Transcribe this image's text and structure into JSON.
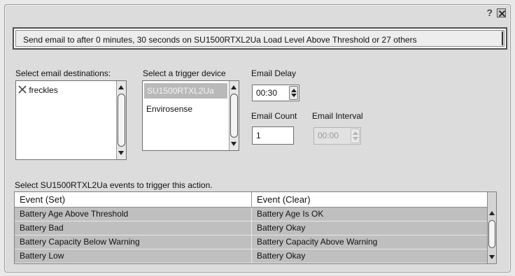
{
  "titlebar": {
    "help_icon": "?",
    "close_icon": "close-box-icon"
  },
  "summary": "Send email to  after 0 minutes, 30 seconds on SU1500RTXL2Ua Load Level Above Threshold or 27 others",
  "destinations": {
    "label": "Select email destinations:",
    "items": [
      {
        "label": "freckles",
        "icon": "x-mark-icon"
      }
    ]
  },
  "trigger_device": {
    "label": "Select a trigger device",
    "items": [
      {
        "label": "SU1500RTXL2Ua",
        "selected": true
      },
      {
        "label": "Envirosense",
        "selected": false
      }
    ]
  },
  "email_delay": {
    "label": "Email Delay",
    "value": "00:30"
  },
  "email_count": {
    "label": "Email Count",
    "value": "1"
  },
  "email_interval": {
    "label": "Email Interval",
    "value": "00:00",
    "disabled": true
  },
  "events": {
    "label": "Select SU1500RTXL2Ua events to trigger this action.",
    "columns": [
      "Event (Set)",
      "Event (Clear)"
    ],
    "rows": [
      [
        "Battery Age Above Threshold",
        "Battery Age Is OK"
      ],
      [
        "Battery Bad",
        "Battery Okay"
      ],
      [
        "Battery Capacity Below Warning",
        "Battery Capacity Above Warning"
      ],
      [
        "Battery Low",
        "Battery Okay"
      ]
    ]
  },
  "colors": {
    "selected_row": "#b9b9b9",
    "dialog_bg": "#dcdcdc"
  }
}
